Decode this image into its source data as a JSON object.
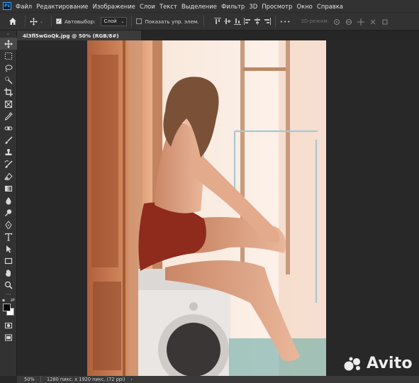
{
  "app": {
    "name": "Photoshop",
    "logo_text": "Ps"
  },
  "menu": [
    "Файл",
    "Редактирование",
    "Изображение",
    "Слои",
    "Текст",
    "Выделение",
    "Фильтр",
    "3D",
    "Просмотр",
    "Окно",
    "Справка"
  ],
  "options": {
    "autoselect_label": "Автовыбор:",
    "autoselect_checked": true,
    "autoselect_value": "Слой",
    "show_transform_label": "Показать упр. элем.",
    "show_transform_checked": false,
    "more": "•••",
    "three_d_mode_label": "3D-режим:"
  },
  "document": {
    "tab_title": "4l3fl5wGoQk.jpg @ 50% (RGB/8#)"
  },
  "tools": [
    "move-tool",
    "marquee-tool",
    "lasso-tool",
    "quick-select-tool",
    "crop-tool",
    "frame-tool",
    "eyedropper-tool",
    "healing-brush-tool",
    "brush-tool",
    "clone-stamp-tool",
    "history-brush-tool",
    "eraser-tool",
    "gradient-tool",
    "blur-tool",
    "dodge-tool",
    "pen-tool",
    "type-tool",
    "path-selection-tool",
    "rectangle-tool",
    "hand-tool",
    "zoom-tool"
  ],
  "colors": {
    "foreground": "#000000",
    "background": "#ffffff"
  },
  "status": {
    "zoom": "50%",
    "doc_info": "1280 пикс. x 1920 пикс. (72 ppi)",
    "arrow": "›"
  },
  "watermark": {
    "text": "Avito"
  }
}
